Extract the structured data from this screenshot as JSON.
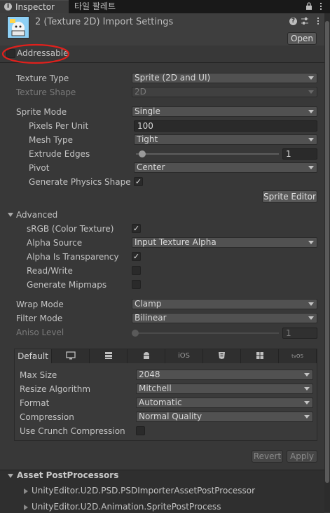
{
  "tabs": {
    "inspector": "Inspector",
    "tile_palette": "타일 팔레트"
  },
  "header": {
    "title": "2 (Texture 2D) Import Settings",
    "open_button": "Open"
  },
  "addressable": {
    "label": "Addressable",
    "checked": false
  },
  "texture": {
    "type_label": "Texture Type",
    "type_value": "Sprite (2D and UI)",
    "shape_label": "Texture Shape",
    "shape_value": "2D",
    "sprite_mode_label": "Sprite Mode",
    "sprite_mode_value": "Single",
    "ppu_label": "Pixels Per Unit",
    "ppu_value": "100",
    "mesh_type_label": "Mesh Type",
    "mesh_type_value": "Tight",
    "extrude_label": "Extrude Edges",
    "extrude_value": "1",
    "pivot_label": "Pivot",
    "pivot_value": "Center",
    "gen_physics_label": "Generate Physics Shape",
    "sprite_editor_button": "Sprite Editor"
  },
  "advanced": {
    "label": "Advanced",
    "srgb_label": "sRGB (Color Texture)",
    "alpha_source_label": "Alpha Source",
    "alpha_source_value": "Input Texture Alpha",
    "alpha_transparency_label": "Alpha Is Transparency",
    "read_write_label": "Read/Write",
    "mipmaps_label": "Generate Mipmaps"
  },
  "sampling": {
    "wrap_label": "Wrap Mode",
    "wrap_value": "Clamp",
    "filter_label": "Filter Mode",
    "filter_value": "Bilinear",
    "aniso_label": "Aniso Level",
    "aniso_value": "1"
  },
  "platform": {
    "default_tab": "Default",
    "ios_tab": "iOS",
    "tvos_tab": "tvOS",
    "max_size_label": "Max Size",
    "max_size_value": "2048",
    "resize_label": "Resize Algorithm",
    "resize_value": "Mitchell",
    "format_label": "Format",
    "format_value": "Automatic",
    "compression_label": "Compression",
    "compression_value": "Normal Quality",
    "crunch_label": "Use Crunch Compression"
  },
  "actions": {
    "revert": "Revert",
    "apply": "Apply"
  },
  "postprocessors": {
    "label": "Asset PostProcessors",
    "items": [
      "UnityEditor.U2D.PSD.PSDImporterAssetPostProcessor",
      "UnityEditor.U2D.Animation.SpritePostProcess"
    ]
  },
  "colors": {
    "background": "#383838",
    "highlight_circle": "#e0201c"
  }
}
